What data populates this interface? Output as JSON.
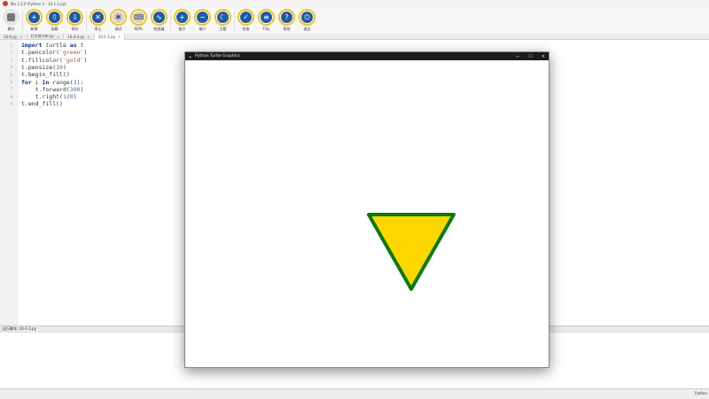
{
  "window": {
    "title": "Mu 1.2.0 (Python 3 - 10-1-1.py)"
  },
  "toolbar": {
    "buttons": [
      {
        "label": "模式",
        "icon": "mode-icon"
      },
      {
        "label": "新建",
        "icon": "plus-icon",
        "glyph": "+"
      },
      {
        "label": "加载",
        "icon": "upload-icon",
        "glyph": "⇧"
      },
      {
        "label": "保存",
        "icon": "download-icon",
        "glyph": "⇩"
      },
      {
        "label": "停止",
        "icon": "stop-icon",
        "glyph": "✕"
      },
      {
        "label": "调试",
        "icon": "bug-icon",
        "glyph": "✱"
      },
      {
        "label": "REPL",
        "icon": "keyboard-icon",
        "glyph": "⌨"
      },
      {
        "label": "绘图器",
        "icon": "plotter-icon",
        "glyph": "∿"
      },
      {
        "label": "放大",
        "icon": "zoom-in-icon",
        "glyph": "+"
      },
      {
        "label": "缩小",
        "icon": "zoom-out-icon",
        "glyph": "−"
      },
      {
        "label": "主题",
        "icon": "moon-icon",
        "glyph": "☾"
      },
      {
        "label": "检查",
        "icon": "thumbs-up-icon",
        "glyph": "✓"
      },
      {
        "label": "Tidy",
        "icon": "menu-icon",
        "glyph": "≡"
      },
      {
        "label": "帮助",
        "icon": "help-icon",
        "glyph": "?"
      },
      {
        "label": "退出",
        "icon": "power-icon",
        "glyph": "⏻"
      }
    ]
  },
  "tabs": [
    {
      "label": "10-6.py"
    },
    {
      "label": "石头剪刀布.py"
    },
    {
      "label": "10-4-4.py"
    },
    {
      "label": "10-1-1.py"
    }
  ],
  "editor": {
    "lines": [
      {
        "n": "1",
        "html": "<span class=\"kw\">import</span> turtle <span class=\"kw\">as</span> t"
      },
      {
        "n": "2",
        "html": "t.pencolor(<span class=\"str\">'green'</span>)"
      },
      {
        "n": "3",
        "html": "t.fillcolor(<span class=\"str\">'gold'</span>)"
      },
      {
        "n": "4",
        "html": "t.pensize(<span class=\"num\">10</span>)"
      },
      {
        "n": "5",
        "html": "t.begin_fill()"
      },
      {
        "n": "6",
        "html": "<span class=\"kw\">for</span> i <span class=\"kw\">in</span> range(<span class=\"num\">3</span>):"
      },
      {
        "n": "7",
        "html": "    t.forward(<span class=\"num\">300</span>)"
      },
      {
        "n": "8",
        "html": "    t.right(<span class=\"num\">120</span>)"
      },
      {
        "n": "9",
        "html": "t.end_fill()"
      }
    ]
  },
  "status": {
    "running": "运行脚本: 10-1-1.py"
  },
  "footer": {
    "mode": "Python"
  },
  "turtle_window": {
    "title": "Python Turtle Graphics",
    "min": "—",
    "max": "☐",
    "close": "✕",
    "pencolor": "#0a7a0a",
    "fillcolor": "#ffd700"
  }
}
